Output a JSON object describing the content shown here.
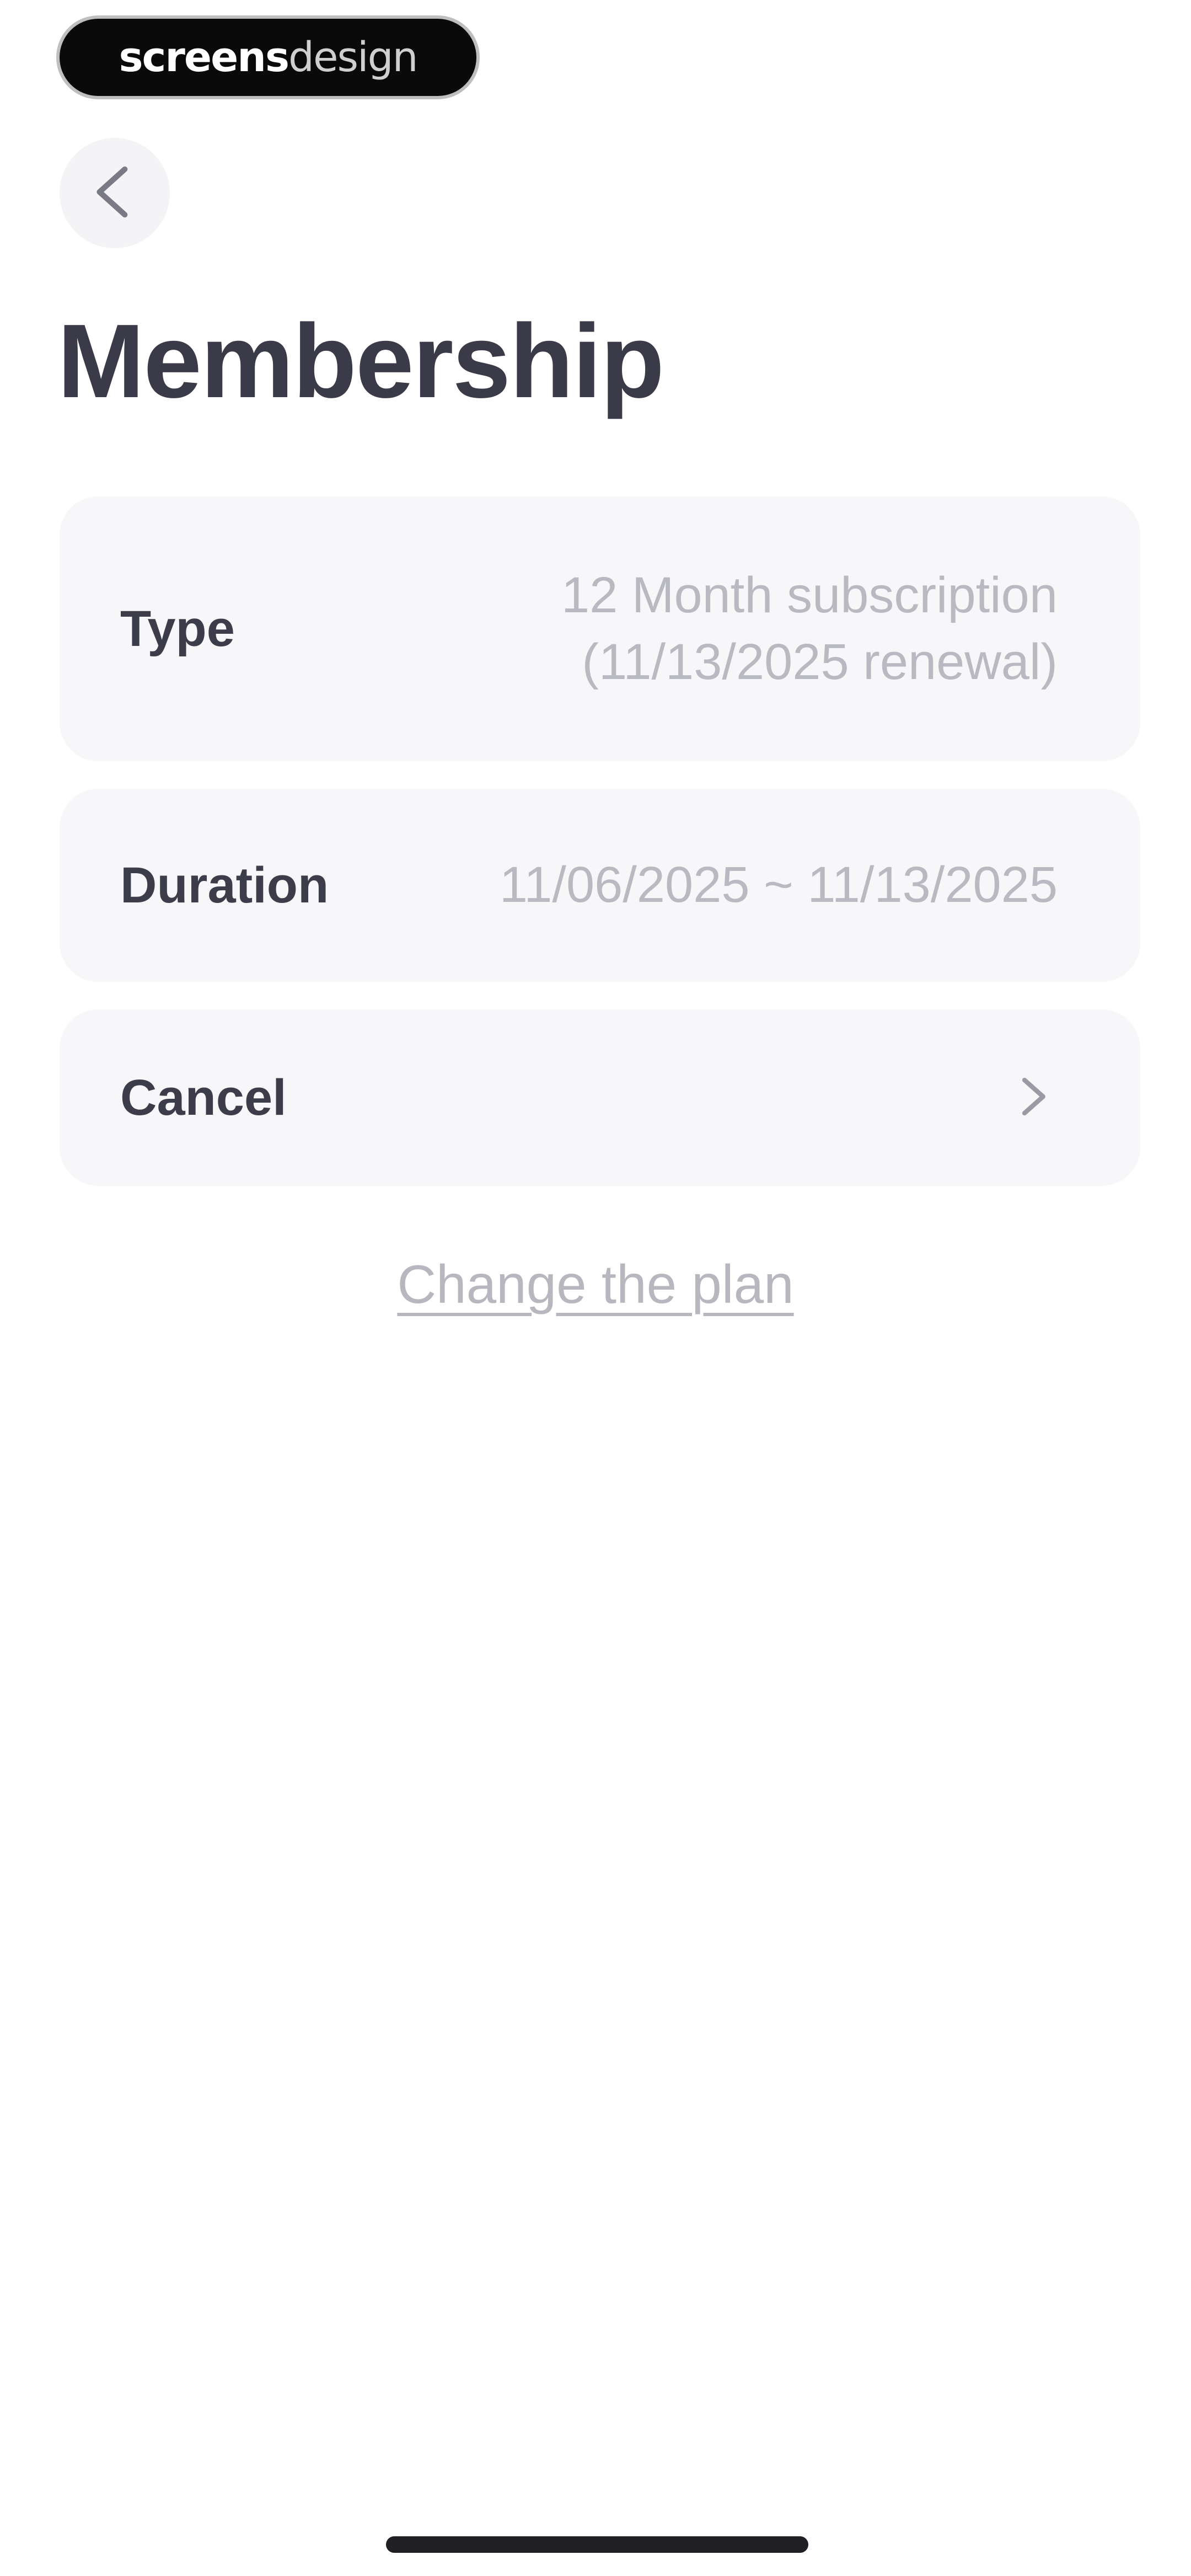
{
  "watermark": {
    "part1": "screens",
    "part2": "design"
  },
  "header": {
    "back_icon": "chevron-left-icon",
    "title": "Membership"
  },
  "rows": {
    "type": {
      "label": "Type",
      "value_line1": "12 Month subscription",
      "value_line2": "(11/13/2025 renewal)"
    },
    "duration": {
      "label": "Duration",
      "value": "11/06/2025 ~ 11/13/2025"
    },
    "cancel": {
      "label": "Cancel",
      "icon": "chevron-right-icon"
    }
  },
  "footer": {
    "change_plan_link": "Change the plan"
  },
  "colors": {
    "background": "#ffffff",
    "card": "#f7f7f9",
    "title": "#3a3a48",
    "muted": "#b9b9c1"
  }
}
